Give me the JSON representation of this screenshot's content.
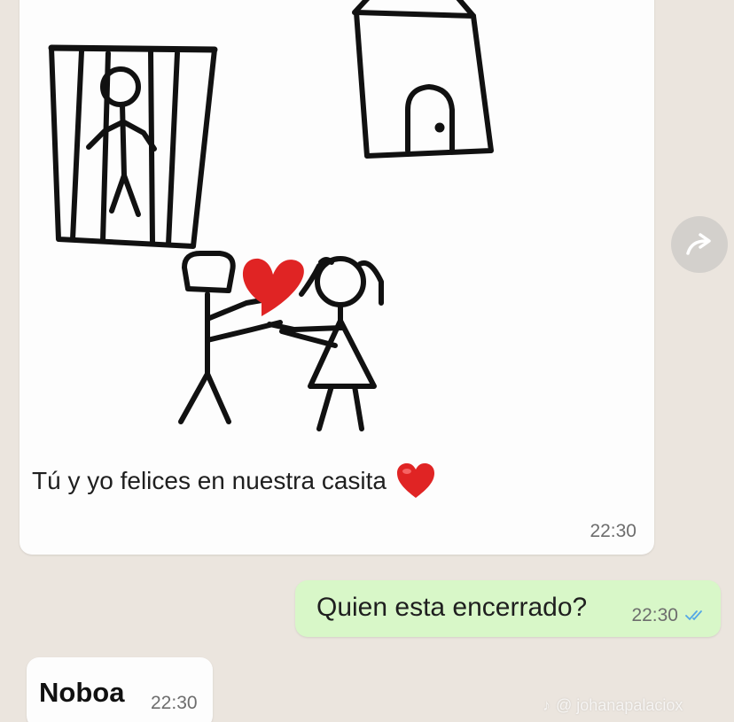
{
  "chat": {
    "image_message": {
      "caption": "Tú y yo felices en nuestra casita",
      "caption_emoji": "red-heart-icon",
      "time": "22:30"
    },
    "outgoing_message": {
      "text": "Quien esta encerrado?",
      "time": "22:30",
      "status_icon": "double-check-icon"
    },
    "incoming_message": {
      "text": "Noboa",
      "time": "22:30"
    },
    "forward_icon": "forward-arrow-icon"
  },
  "watermark": {
    "platform_icon": "tiktok-icon",
    "handle": "@ johanapalaciox"
  },
  "colors": {
    "background": "#ebe5de",
    "incoming_bubble": "#fdfdfd",
    "outgoing_bubble": "#d8f7c8",
    "heart": "#e02424",
    "read_ticks": "#53a6e6"
  }
}
